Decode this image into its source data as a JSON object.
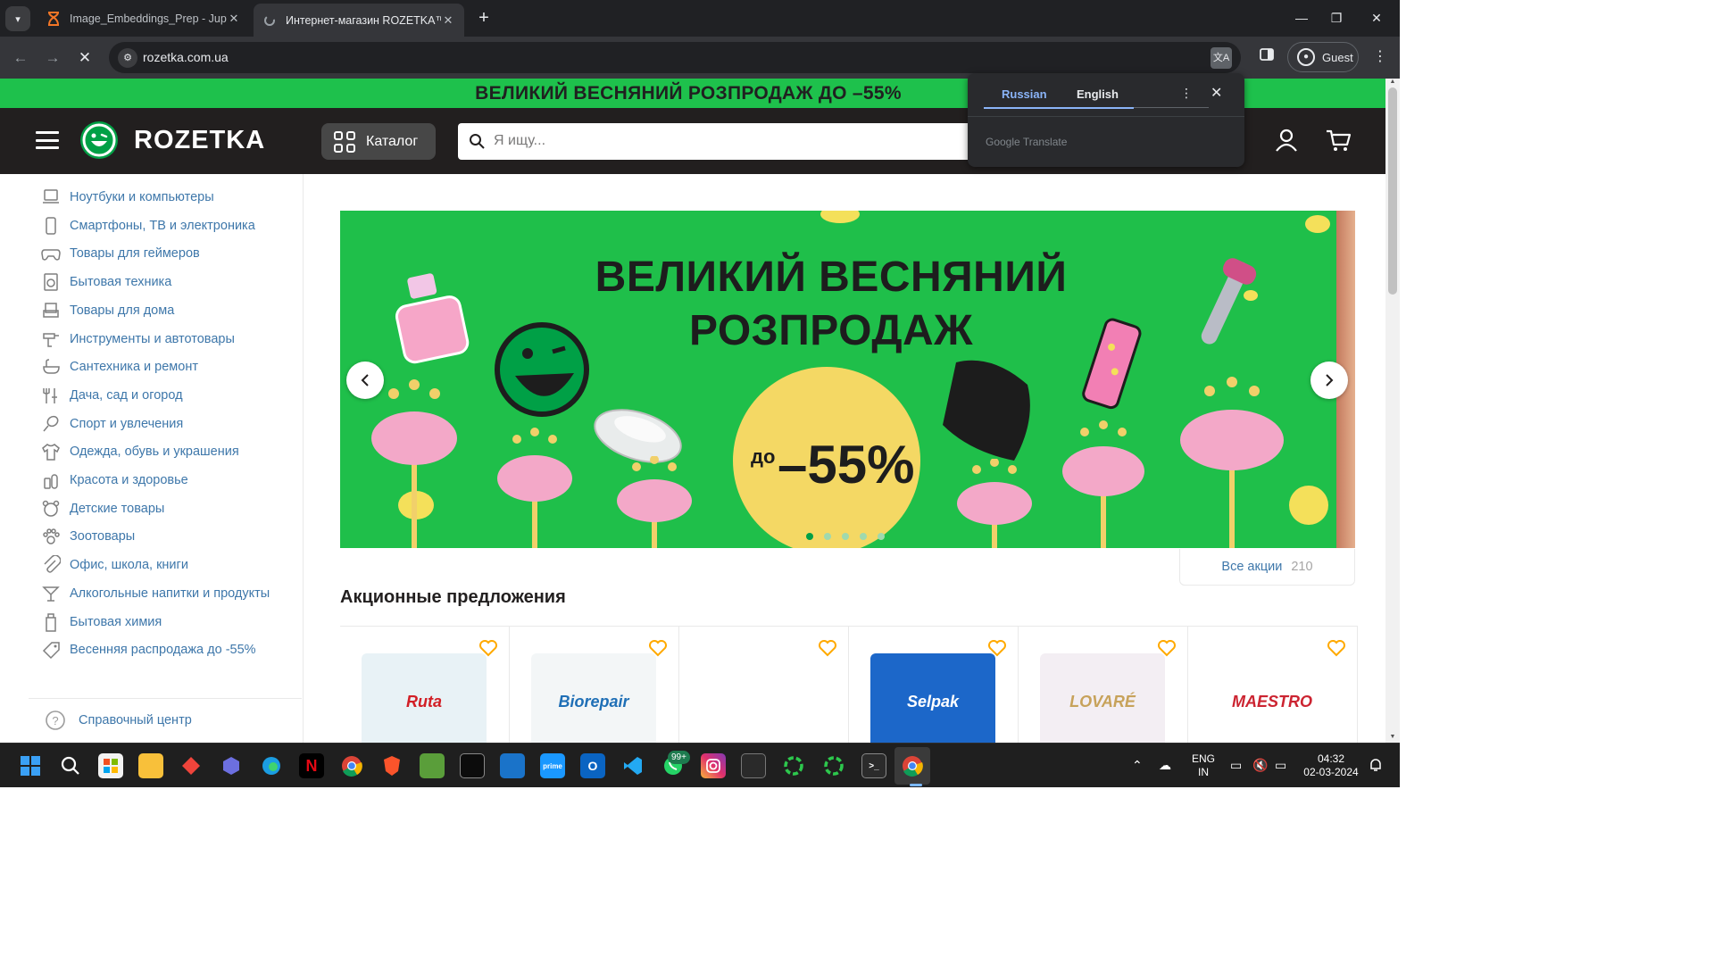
{
  "browser": {
    "tabs": [
      {
        "title": "Image_Embeddings_Prep - Jupyter",
        "icon": "hourglass-icon",
        "active": false
      },
      {
        "title": "Интернет-магазин ROZETKA™: офи",
        "icon": "loading-icon",
        "active": true
      }
    ],
    "url": "rozetka.com.ua",
    "profile_label": "Guest"
  },
  "translate_popup": {
    "source_lang": "Russian",
    "target_lang": "English",
    "brand": "Google Translate"
  },
  "site": {
    "promo_strip": "ВЕЛИКИЙ ВЕСНЯНИЙ РОЗПРОДАЖ ДО –55%",
    "logo": "ROZETKA",
    "catalog_label": "Каталог",
    "search_placeholder": "Я ищу..."
  },
  "sidebar": {
    "categories": [
      {
        "label": "Ноутбуки и компьютеры",
        "icon": "laptop-icon"
      },
      {
        "label": "Смартфоны, ТВ и электроника",
        "icon": "smartphone-icon"
      },
      {
        "label": "Товары для геймеров",
        "icon": "gamepad-icon"
      },
      {
        "label": "Бытовая техника",
        "icon": "washing-machine-icon"
      },
      {
        "label": "Товары для дома",
        "icon": "sofa-icon"
      },
      {
        "label": "Инструменты и автотовары",
        "icon": "drill-icon"
      },
      {
        "label": "Сантехника и ремонт",
        "icon": "bathtub-icon"
      },
      {
        "label": "Дача, сад и огород",
        "icon": "garden-tools-icon"
      },
      {
        "label": "Спорт и увлечения",
        "icon": "racket-icon"
      },
      {
        "label": "Одежда, обувь и украшения",
        "icon": "shirt-icon"
      },
      {
        "label": "Красота и здоровье",
        "icon": "cosmetics-icon"
      },
      {
        "label": "Детские товары",
        "icon": "teddy-bear-icon"
      },
      {
        "label": "Зоотовары",
        "icon": "paw-icon"
      },
      {
        "label": "Офис, школа, книги",
        "icon": "paperclip-icon"
      },
      {
        "label": "Алкогольные напитки и продукты",
        "icon": "cocktail-icon"
      },
      {
        "label": "Бытовая химия",
        "icon": "detergent-icon"
      },
      {
        "label": "Весенняя распродажа до -55%",
        "icon": "tag-icon"
      }
    ],
    "help_label": "Справочный центр"
  },
  "banner": {
    "title_line1": "ВЕЛИКИЙ ВЕСНЯНИЙ",
    "title_line2": "РОЗПРОДАЖ",
    "badge_prefix": "до",
    "badge_value": "–55%",
    "slide_count": 5,
    "active_slide": 0
  },
  "promos": {
    "all_label": "Все акции",
    "all_count": "210",
    "section_title": "Акционные предложения",
    "products": [
      {
        "brand": "Ruta",
        "colors": [
          "#e8f2f6",
          "#d21f26"
        ]
      },
      {
        "brand": "Biorepair",
        "colors": [
          "#f3f6f7",
          "#1f6fb6"
        ]
      },
      {
        "brand": "",
        "colors": [
          "#ffffff",
          "#1c1c1c"
        ]
      },
      {
        "brand": "Selpak",
        "colors": [
          "#1c67c9",
          "#ffffff"
        ]
      },
      {
        "brand": "LOVARÉ",
        "colors": [
          "#f3eef3",
          "#c7a25a"
        ]
      },
      {
        "brand": "MAESTRO",
        "colors": [
          "#ffffff",
          "#cc2431"
        ]
      }
    ]
  },
  "taskbar": {
    "whatsapp_badge": "99+",
    "lang_line1": "ENG",
    "lang_line2": "IN",
    "time": "04:32",
    "date": "02-03-2024"
  }
}
